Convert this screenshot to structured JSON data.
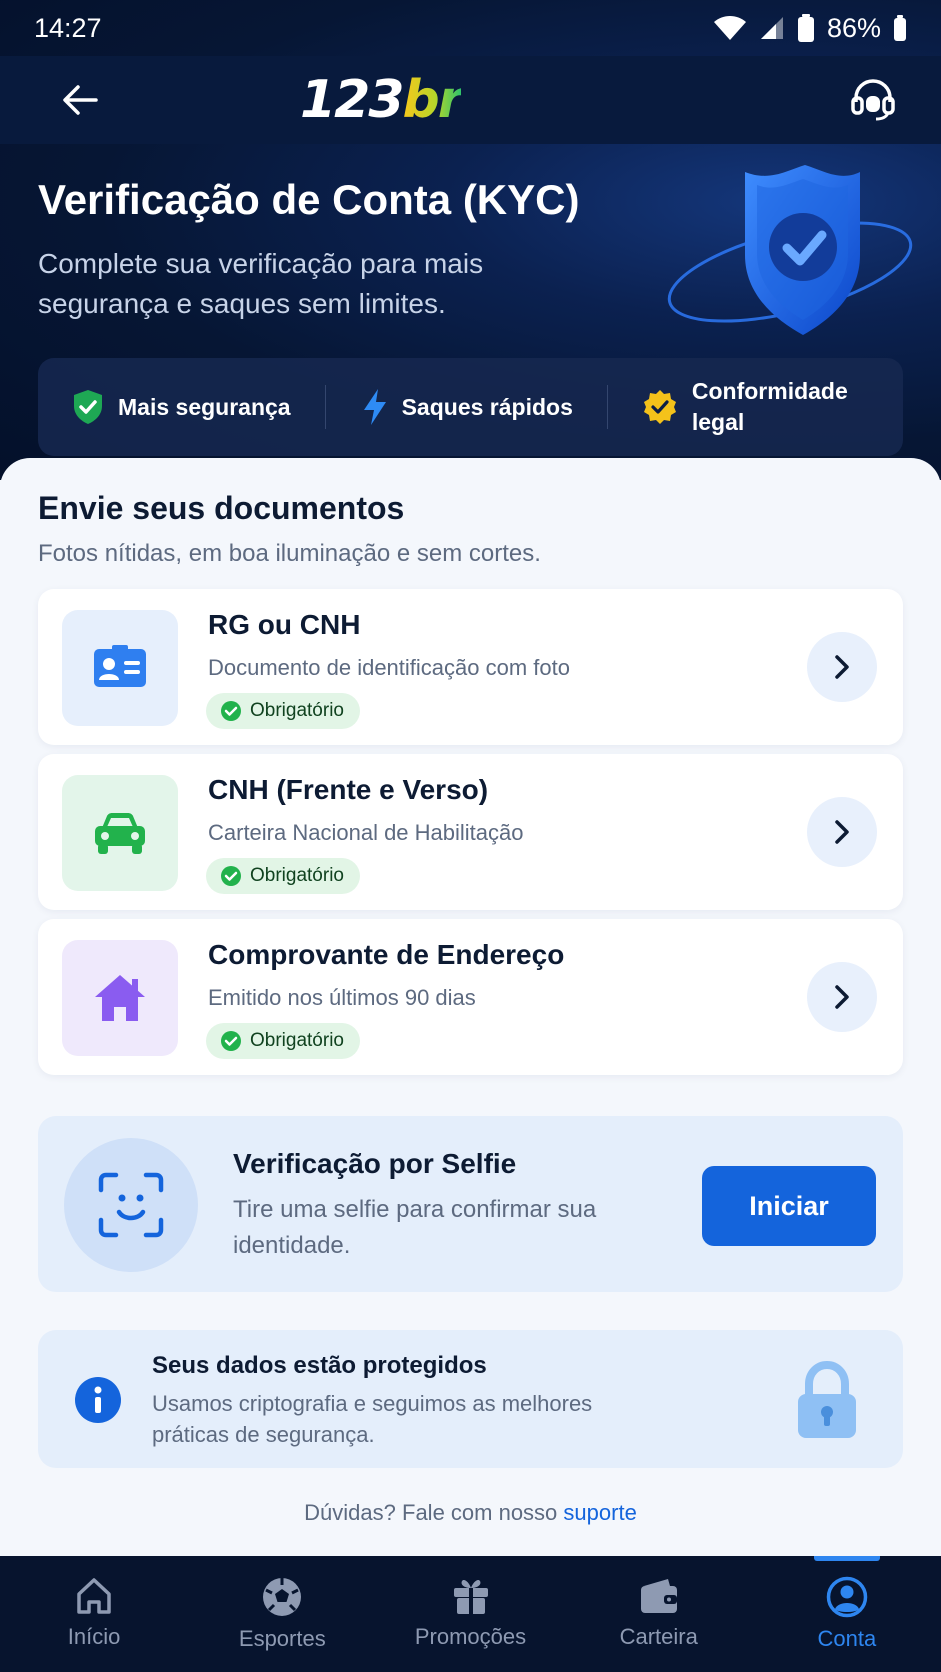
{
  "status_bar": {
    "time": "14:27",
    "battery": "86%"
  },
  "app_bar": {
    "logo_number": "123",
    "logo_suffix": "br"
  },
  "hero": {
    "title": "Verificação de Conta (KYC)",
    "subtitle": "Complete sua verificação para mais segurança e saques sem limites."
  },
  "features": [
    {
      "label": "Mais segurança",
      "icon": "shield-check-icon"
    },
    {
      "label": "Saques rápidos",
      "icon": "lightning-icon"
    },
    {
      "label": "Conformidade legal",
      "icon": "verified-badge-icon"
    }
  ],
  "documents_section": {
    "title": "Envie seus documentos",
    "subtitle": "Fotos nítidas, em boa iluminação e sem cortes."
  },
  "documents": [
    {
      "title": "RG ou CNH",
      "description": "Documento de identificação com foto",
      "badge": "Obrigatório",
      "icon": "id-card-icon"
    },
    {
      "title": "CNH (Frente e Verso)",
      "description": "Carteira Nacional de Habilitação",
      "badge": "Obrigatório",
      "icon": "car-icon"
    },
    {
      "title": "Comprovante de Endereço",
      "description": "Emitido nos últimos 90 dias",
      "badge": "Obrigatório",
      "icon": "house-icon"
    }
  ],
  "selfie": {
    "title": "Verificação por Selfie",
    "description": "Tire uma selfie para confirmar sua identidade.",
    "button": "Iniciar"
  },
  "protection": {
    "title": "Seus dados estão protegidos",
    "description": "Usamos criptografia e seguimos as melhores práticas de segurança."
  },
  "help": {
    "text": "Dúvidas? Fale com nosso",
    "link": "suporte"
  },
  "bottom_nav": [
    {
      "label": "Início",
      "icon": "home-icon"
    },
    {
      "label": "Esportes",
      "icon": "soccer-ball-icon"
    },
    {
      "label": "Promoções",
      "icon": "gift-icon"
    },
    {
      "label": "Carteira",
      "icon": "wallet-icon"
    },
    {
      "label": "Conta",
      "icon": "user-circle-icon",
      "active": true
    }
  ],
  "colors": {
    "primary": "#1464dc",
    "header_dark": "#061634",
    "success_green": "#22b24c",
    "badge_bg": "#e2f5e6"
  }
}
